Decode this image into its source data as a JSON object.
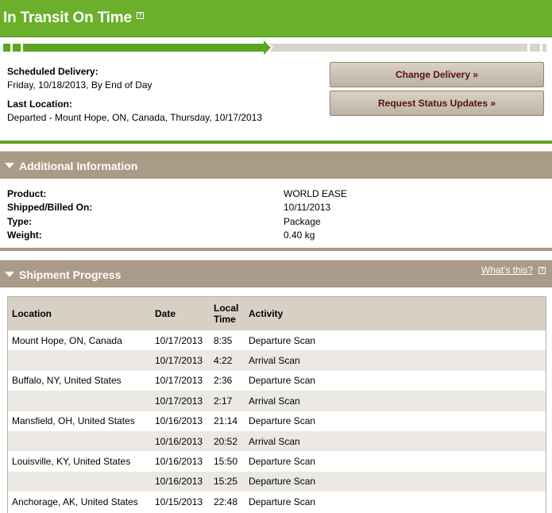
{
  "header": {
    "title": "In Transit On Time",
    "help": "?"
  },
  "progress": {
    "fraction": 0.49
  },
  "summary": {
    "scheduled_label": "Scheduled Delivery:",
    "scheduled_value": "Friday, 10/18/2013, By End of Day",
    "last_label": "Last Location:",
    "last_value": "Departed - Mount Hope, ON, Canada, Thursday, 10/17/2013",
    "change_button": "Change Delivery »",
    "status_button": "Request Status Updates »"
  },
  "additional": {
    "title": "Additional Information",
    "rows": [
      {
        "label": "Product:",
        "value": "WORLD EASE"
      },
      {
        "label": "Shipped/Billed On:",
        "value": "10/11/2013"
      },
      {
        "label": "Type:",
        "value": "Package"
      },
      {
        "label": "Weight:",
        "value": "0.40 kg"
      }
    ]
  },
  "progress_section": {
    "title": "Shipment Progress",
    "whats_this": "What's this?",
    "help": "?",
    "columns": {
      "location": "Location",
      "date": "Date",
      "time_line1": "Local",
      "time_line2": "Time",
      "activity": "Activity"
    },
    "rows": [
      {
        "location": "Mount Hope, ON, Canada",
        "date": "10/17/2013",
        "time": "8:35",
        "activity": "Departure Scan"
      },
      {
        "location": "",
        "date": "10/17/2013",
        "time": "4:22",
        "activity": "Arrival Scan"
      },
      {
        "location": "Buffalo, NY, United States",
        "date": "10/17/2013",
        "time": "2:36",
        "activity": "Departure Scan"
      },
      {
        "location": "",
        "date": "10/17/2013",
        "time": "2:17",
        "activity": "Arrival Scan"
      },
      {
        "location": "Mansfield, OH, United States",
        "date": "10/16/2013",
        "time": "21:14",
        "activity": "Departure Scan"
      },
      {
        "location": "",
        "date": "10/16/2013",
        "time": "20:52",
        "activity": "Arrival Scan"
      },
      {
        "location": "Louisville, KY, United States",
        "date": "10/16/2013",
        "time": "15:50",
        "activity": "Departure Scan"
      },
      {
        "location": "",
        "date": "10/16/2013",
        "time": "15:25",
        "activity": "Departure Scan"
      },
      {
        "location": "Anchorage, AK, United States",
        "date": "10/15/2013",
        "time": "22:48",
        "activity": "Departure Scan"
      }
    ]
  }
}
